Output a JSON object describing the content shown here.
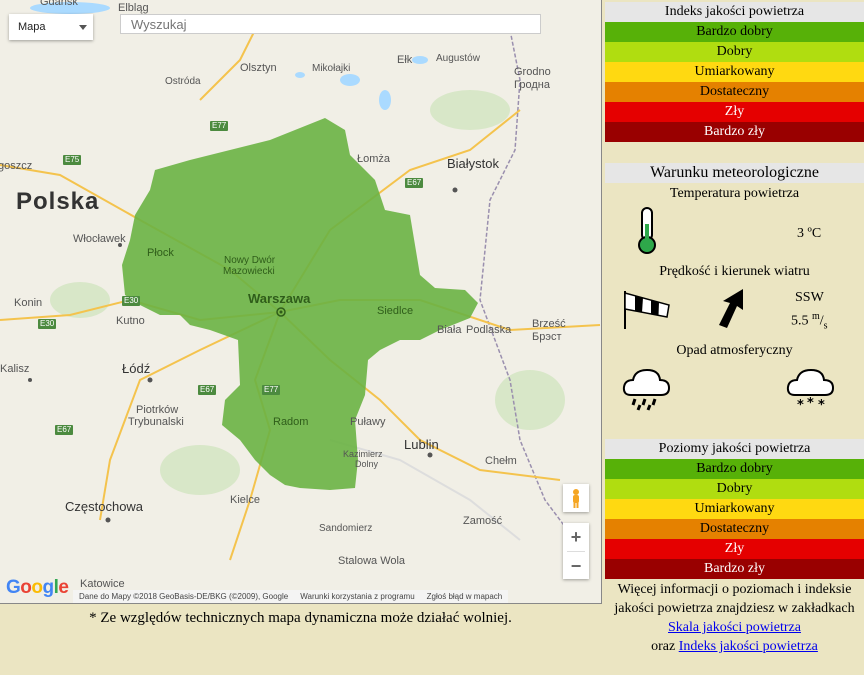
{
  "map": {
    "map_type": "Mapa",
    "search_placeholder": "Wyszukaj",
    "zoom_in": "+",
    "zoom_out": "−",
    "google_logo": "Google",
    "attribution": "Dane do Mapy ©2018 GeoBasis-DE/BKG (©2009), Google",
    "terms": "Warunki korzystania z programu",
    "report": "Zgłoś błąd w mapach",
    "highlight_color": "#6ab344",
    "country": "Polska",
    "cities": {
      "gdansk": "Gdańsk",
      "elblag": "Elbląg",
      "olsztyn": "Olsztyn",
      "mikolajki": "Mikołajki",
      "elk": "Ełk",
      "augustow": "Augustów",
      "grodno": "Grodno",
      "grodno_cyr": "Гродна",
      "ostroda": "Ostróda",
      "bartoszyce": "goszcz",
      "lomza": "Łomża",
      "bialystok": "Białystok",
      "wloclawek": "Włocławek",
      "plock": "Płock",
      "nowy_dwor": "Nowy Dwór",
      "mazowiecki": "Mazowiecki",
      "warszawa": "Warszawa",
      "siedlce": "Siedlce",
      "konin": "Konin",
      "kutno": "Kutno",
      "biala": "Biała",
      "podlaska": "Podlaska",
      "brzesc": "Brześć",
      "brest": "Брэст",
      "kalisz": "Kalisz",
      "lodz": "Łódź",
      "piotrkow": "Piotrków",
      "trybunalski": "Trybunalski",
      "radom": "Radom",
      "pulawy": "Puławy",
      "kazimierz": "Kazimierz",
      "dolny": "Dolny",
      "lublin": "Lublin",
      "chelm": "Chełm",
      "czestochowa": "Częstochowa",
      "kielce": "Kielce",
      "zamosc": "Zamość",
      "sandomierz": "Sandomierz",
      "stalowa_wola": "Stalowa Wola",
      "katowice": "Katowice"
    },
    "roads": {
      "e77a": "E77",
      "e75": "E75",
      "e67a": "E67",
      "e30": "E30",
      "e67b": "E67",
      "e77b": "E77",
      "e67c": "E67",
      "e372": "E372"
    }
  },
  "footnote": "* Ze względów technicznych mapa dynamiczna może działać wolniej.",
  "index_panel": {
    "title": "Indeks jakości powietrza",
    "levels": [
      {
        "label": "Bardzo dobry",
        "color": "#57b108"
      },
      {
        "label": "Dobry",
        "color": "#b0dd10"
      },
      {
        "label": "Umiarkowany",
        "color": "#ffd911"
      },
      {
        "label": "Dostateczny",
        "color": "#e58100"
      },
      {
        "label": "Zły",
        "color": "#e50000"
      },
      {
        "label": "Bardzo zły",
        "color": "#990000"
      }
    ]
  },
  "meteo": {
    "title": "Warunku meteorologiczne",
    "temp_label": "Temperatura powietrza",
    "temp_value": "3 ºC",
    "wind_label": "Prędkość i kierunek wiatru",
    "wind_direction": "SSW",
    "wind_speed": "5.5",
    "wind_unit_top": "m",
    "wind_unit_bottom": "s",
    "precip_label": "Opad atmosferyczny"
  },
  "levels_panel": {
    "title": "Poziomy jakości powietrza",
    "levels": [
      {
        "label": "Bardzo dobry",
        "color": "#57b108"
      },
      {
        "label": "Dobry",
        "color": "#b0dd10"
      },
      {
        "label": "Umiarkowany",
        "color": "#ffd911"
      },
      {
        "label": "Dostateczny",
        "color": "#e58100"
      },
      {
        "label": "Zły",
        "color": "#e50000"
      },
      {
        "label": "Bardzo zły",
        "color": "#990000"
      }
    ]
  },
  "info": {
    "text1": "Więcej informacji o poziomach i indeksie jakości powietrza znajdziesz w zakładkach",
    "link1": "Skala jakości powietrza",
    "text2": "oraz",
    "link2": "Indeks jakości powietrza"
  }
}
